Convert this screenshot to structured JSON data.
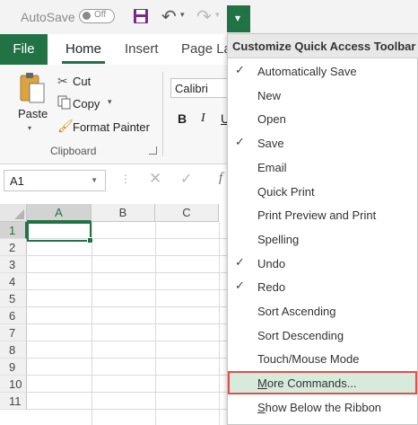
{
  "qat": {
    "autosave_label": "AutoSave",
    "autosave_state": "Off",
    "customize_glyph": "▾"
  },
  "tabs": {
    "file": "File",
    "home": "Home",
    "insert": "Insert",
    "page_layout": "Page La"
  },
  "clipboard": {
    "paste": "Paste",
    "cut": "Cut",
    "copy": "Copy",
    "format_painter": "Format Painter",
    "group_label": "Clipboard"
  },
  "font": {
    "name": "Calibri",
    "bold": "B",
    "italic": "I",
    "underline": "U"
  },
  "formula_bar": {
    "name_box": "A1",
    "fx": "f"
  },
  "grid": {
    "columns": [
      "A",
      "B",
      "C"
    ],
    "rows": [
      "1",
      "2",
      "3",
      "4",
      "5",
      "6",
      "7",
      "8",
      "9",
      "10",
      "11"
    ],
    "selected_column": "A",
    "selected_row": "1"
  },
  "menu": {
    "title": "Customize Quick Access Toolbar",
    "items": [
      {
        "label": "Automatically Save",
        "checked": true
      },
      {
        "label": "New",
        "checked": false
      },
      {
        "label": "Open",
        "checked": false
      },
      {
        "label": "Save",
        "checked": true
      },
      {
        "label": "Email",
        "checked": false
      },
      {
        "label": "Quick Print",
        "checked": false
      },
      {
        "label": "Print Preview and Print",
        "checked": false
      },
      {
        "label": "Spelling",
        "checked": false
      },
      {
        "label": "Undo",
        "checked": true
      },
      {
        "label": "Redo",
        "checked": true
      },
      {
        "label": "Sort Ascending",
        "checked": false
      },
      {
        "label": "Sort Descending",
        "checked": false
      },
      {
        "label": "Touch/Mouse Mode",
        "checked": false
      },
      {
        "label": "More Commands...",
        "checked": false,
        "highlighted": true
      },
      {
        "label": "Show Below the Ribbon",
        "checked": false
      }
    ],
    "check_glyph": "✓"
  },
  "colors": {
    "accent": "#217346",
    "highlight_border": "#e0504a",
    "highlight_fill": "#d7ebdc"
  }
}
